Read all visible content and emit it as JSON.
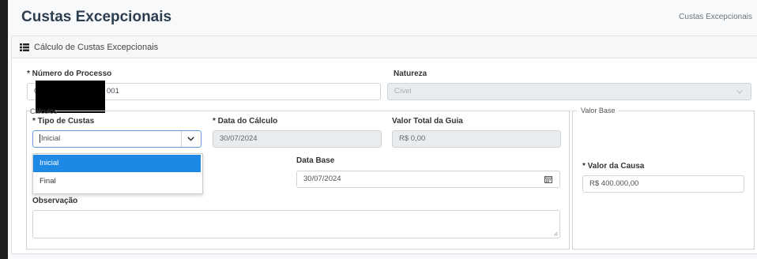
{
  "page": {
    "title": "Custas Excepcionais",
    "breadcrumb": "Custas Excepcionais"
  },
  "card": {
    "title": "Cálculo de Custas Excepcionais",
    "icon": "list-icon"
  },
  "processo": {
    "label": "* Número do Processo",
    "value_prefix": "0",
    "value_suffix": "001"
  },
  "natureza": {
    "label": "Natureza",
    "value": "Cível"
  },
  "calculos": {
    "legend": "Cálculos",
    "tipo_custas": {
      "label": "* Tipo de Custas",
      "value": "Inicial",
      "options": [
        "Inicial",
        "Final"
      ]
    },
    "data_calculo": {
      "label": "* Data do Cálculo",
      "value": "30/07/2024"
    },
    "valor_total_guia": {
      "label": "Valor Total da Guia",
      "value": "R$ 0,00"
    },
    "data_base": {
      "label": "Data Base",
      "value": "30/07/2024",
      "icon": "calendar-icon"
    },
    "observacao": {
      "label": "Observação",
      "value": ""
    }
  },
  "valor_base": {
    "legend": "Valor Base",
    "valor_causa": {
      "label": "* Valor da Causa",
      "value": "R$ 400.000,00"
    }
  },
  "colors": {
    "selected_option": "#1e88e5",
    "readonly_bg": "#e9ecef",
    "title": "#2c3e50"
  }
}
